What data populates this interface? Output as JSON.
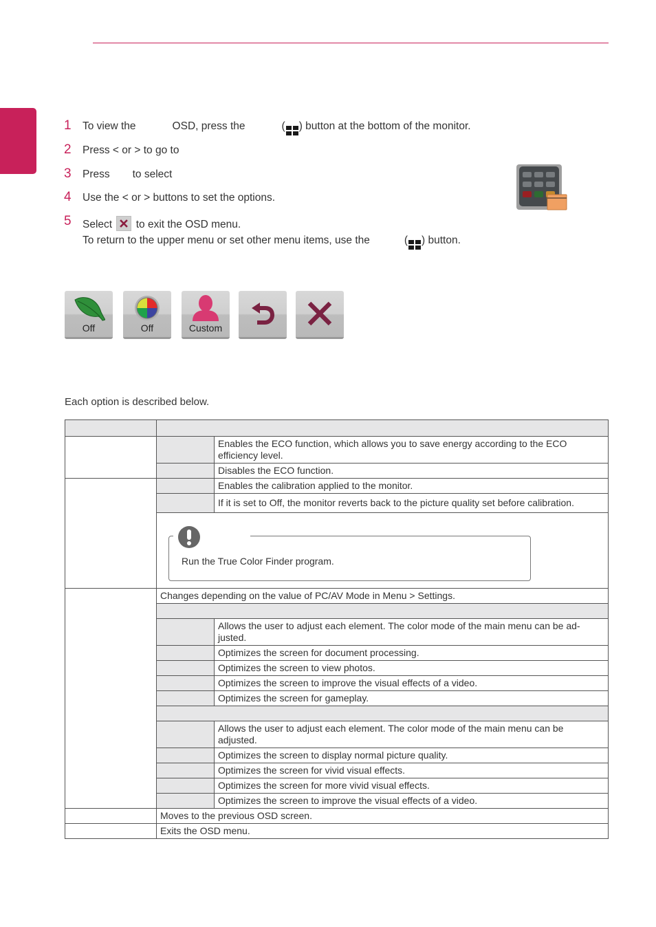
{
  "header": {
    "accent_color": "#c8215a"
  },
  "steps": [
    {
      "num": "1",
      "parts": [
        "To view the",
        "OSD, press the",
        ") button at the bottom of the monitor."
      ],
      "icon": "menu-button-icon"
    },
    {
      "num": "2",
      "text": "Press < or > to go to"
    },
    {
      "num": "3",
      "text_a": "Press",
      "text_b": "to select"
    },
    {
      "num": "4",
      "text": "Use the < or > buttons to set the options."
    },
    {
      "num": "5",
      "text_a": "Select",
      "text_b": "to exit the OSD menu.",
      "icon": "exit-x-icon"
    }
  ],
  "return_note": {
    "text_a": "To return to the upper menu or set other menu items, use the",
    "text_b": ") button."
  },
  "osd_buttons": [
    {
      "icon": "leaf-eco-icon",
      "label": "Off"
    },
    {
      "icon": "color-wheel-icon",
      "label": "Off"
    },
    {
      "icon": "user-profile-icon",
      "label": "Custom"
    },
    {
      "icon": "back-arrow-icon",
      "label": ""
    },
    {
      "icon": "close-x-icon",
      "label": ""
    }
  ],
  "intro": "Each option is described below.",
  "table": {
    "eco": [
      "Enables the ECO function, which allows you to save energy according to the ECO efficiency level.",
      "Disables the ECO function."
    ],
    "calibration": [
      "Enables the calibration applied to the monitor.",
      "If it is set to Off, the monitor reverts back to the picture quality set before calibration."
    ],
    "note": "Run the True Color Finder program.",
    "picture_mode_intro": "Changes depending on the value of PC/AV Mode in Menu > Settings.",
    "pc_modes": [
      "Allows the user to adjust each element. The color mode of the main menu can be ad-justed.",
      "Optimizes the screen for document processing.",
      "Optimizes the screen to view photos.",
      "Optimizes the screen to improve the visual effects of a video.",
      "Optimizes the screen for gameplay."
    ],
    "av_modes": [
      "Allows the user to adjust each element. The color mode of the main menu can be adjusted.",
      "Optimizes the screen to display normal picture quality.",
      "Optimizes the screen for vivid visual effects.",
      "Optimizes the screen for more vivid visual effects.",
      "Optimizes the screen to improve the visual effects of a video."
    ],
    "back": "Moves to the previous OSD screen.",
    "exit": "Exits the OSD menu."
  }
}
